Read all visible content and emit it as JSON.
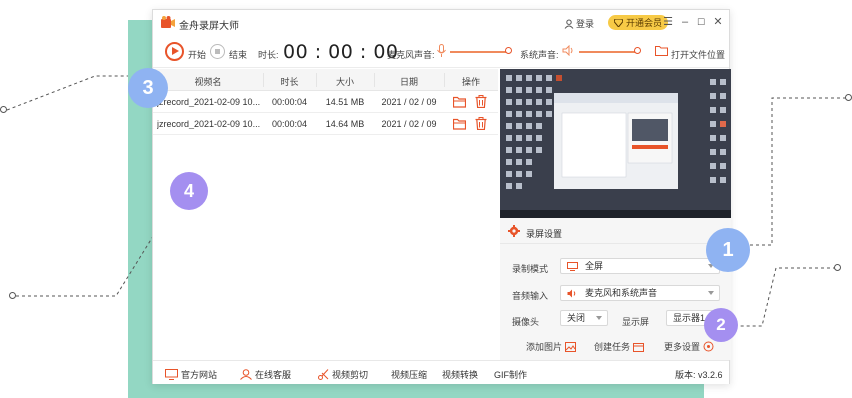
{
  "app": {
    "title": "金舟录屏大师",
    "login": "登录",
    "vip": "开通会员",
    "window_controls": [
      "☰",
      "–",
      "☐",
      "✕"
    ]
  },
  "toolbar": {
    "start": "开始",
    "stop": "结束",
    "duration_label": "时长:",
    "timer": "00 : 00 : 00",
    "mic_label": "麦克风声音:",
    "system_label": "系统声音:",
    "open_folder": "打开文件位置",
    "mic_volume": 1.0,
    "system_volume": 1.0
  },
  "table": {
    "columns": [
      "视频名",
      "时长",
      "大小",
      "日期",
      "操作"
    ],
    "rows": [
      {
        "name": "jzrecord_2021-02-09 10...",
        "duration": "00:00:04",
        "size": "14.51 MB",
        "date": "2021 / 02 / 09"
      },
      {
        "name": "jzrecord_2021-02-09 10...",
        "duration": "00:00:04",
        "size": "14.64 MB",
        "date": "2021 / 02 / 09"
      }
    ]
  },
  "settings": {
    "title": "录屏设置",
    "mode_label": "录制模式",
    "mode_value": "全屏",
    "audio_label": "音频输入",
    "audio_value": "麦克风和系统声音",
    "camera_label": "摄像头",
    "camera_value": "关闭",
    "display_label": "显示屏",
    "display_value": "显示器1",
    "add_image": "添加图片",
    "create_task": "创建任务",
    "more_settings": "更多设置"
  },
  "footer": {
    "website": "官方网站",
    "support": "在线客服",
    "video_edit": "视频剪切",
    "video_compress": "视频压缩",
    "video_convert": "视频转换",
    "gif": "GIF制作",
    "version": "版本: v3.2.6"
  },
  "callouts": {
    "one": "1",
    "two": "2",
    "three": "3",
    "four": "4"
  },
  "colors": {
    "accent": "#e8542a",
    "mint": "#93d7c3",
    "vip": "#f7ca46",
    "badge_blue": "#8fb3f2",
    "badge_purple": "#a48ff0"
  }
}
